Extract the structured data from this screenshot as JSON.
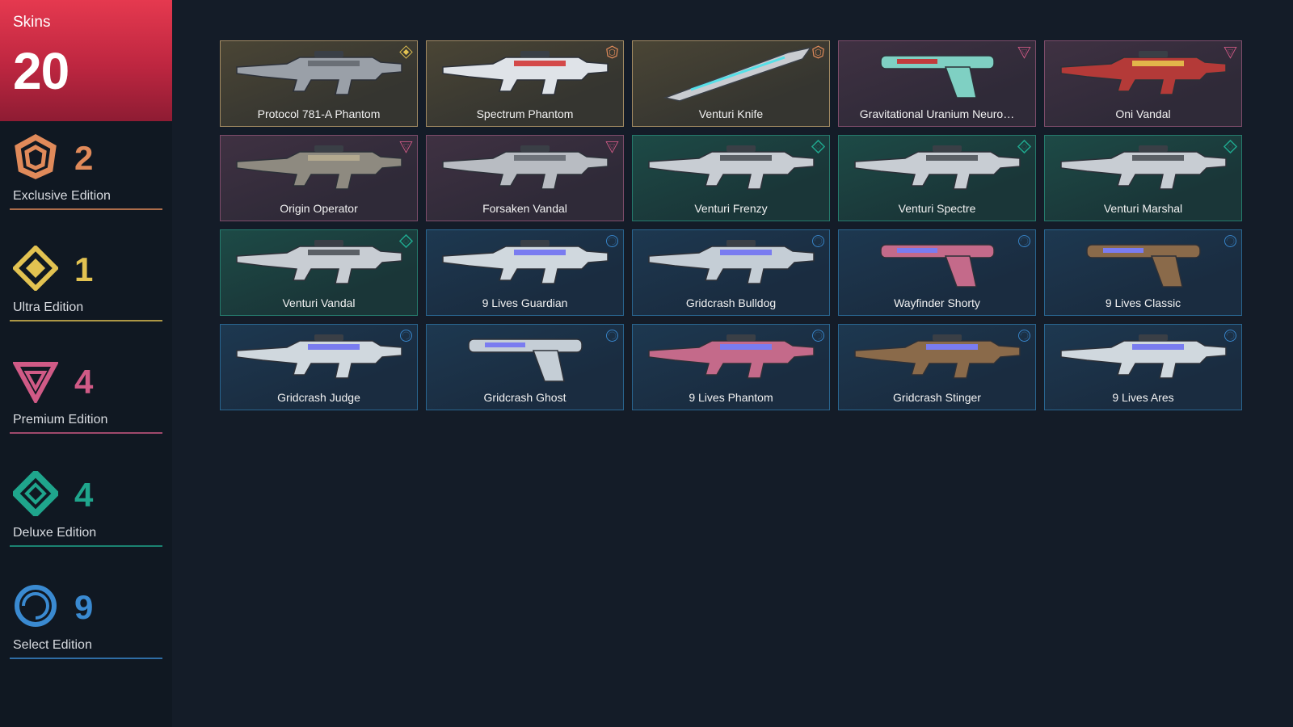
{
  "header": {
    "label": "Skins",
    "count": "20"
  },
  "tiers": [
    {
      "key": "exclusive",
      "name": "Exclusive Edition",
      "count": "2",
      "color": "#e08a5a",
      "icon": "exclusive-edition-icon"
    },
    {
      "key": "ultra",
      "name": "Ultra Edition",
      "count": "1",
      "color": "#e2c251",
      "icon": "ultra-edition-icon"
    },
    {
      "key": "premium",
      "name": "Premium Edition",
      "count": "4",
      "color": "#d05a86",
      "icon": "premium-edition-icon"
    },
    {
      "key": "deluxe",
      "name": "Deluxe Edition",
      "count": "4",
      "color": "#1fa58c",
      "icon": "deluxe-edition-icon"
    },
    {
      "key": "select",
      "name": "Select Edition",
      "count": "9",
      "color": "#3a8ad1",
      "icon": "select-edition-icon"
    }
  ],
  "skins": [
    {
      "name": "Protocol 781-A Phantom",
      "rarity": "ultra"
    },
    {
      "name": "Spectrum Phantom",
      "rarity": "exclusive"
    },
    {
      "name": "Venturi Knife",
      "rarity": "exclusive"
    },
    {
      "name": "Gravitational Uranium Neuro…",
      "rarity": "premium"
    },
    {
      "name": "Oni Vandal",
      "rarity": "premium"
    },
    {
      "name": "Origin Operator",
      "rarity": "premium"
    },
    {
      "name": "Forsaken Vandal",
      "rarity": "premium"
    },
    {
      "name": "Venturi Frenzy",
      "rarity": "deluxe"
    },
    {
      "name": "Venturi Spectre",
      "rarity": "deluxe"
    },
    {
      "name": "Venturi Marshal",
      "rarity": "deluxe"
    },
    {
      "name": "Venturi Vandal",
      "rarity": "deluxe"
    },
    {
      "name": "9 Lives Guardian",
      "rarity": "select"
    },
    {
      "name": "Gridcrash Bulldog",
      "rarity": "select"
    },
    {
      "name": "Wayfinder Shorty",
      "rarity": "select"
    },
    {
      "name": "9 Lives Classic",
      "rarity": "select"
    },
    {
      "name": "Gridcrash Judge",
      "rarity": "select"
    },
    {
      "name": "Gridcrash Ghost",
      "rarity": "select"
    },
    {
      "name": "9 Lives Phantom",
      "rarity": "select"
    },
    {
      "name": "Gridcrash Stinger",
      "rarity": "select"
    },
    {
      "name": "9 Lives Ares",
      "rarity": "select"
    }
  ]
}
